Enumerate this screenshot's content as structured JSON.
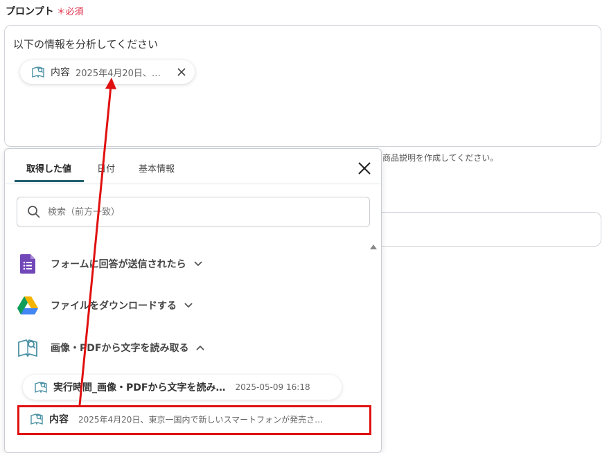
{
  "field": {
    "label": "プロンプト",
    "required_mark": "＊",
    "required_text": "必須"
  },
  "prompt": {
    "text": "以下の情報を分析してください",
    "chip": {
      "name": "内容",
      "value": "2025年4月20日、…",
      "icon": "ocr-book-icon",
      "remove_icon": "close-icon"
    }
  },
  "background": {
    "hint": "商品説明を作成してください。"
  },
  "panel": {
    "tabs": [
      {
        "label": "取得した値"
      },
      {
        "label": "日付"
      },
      {
        "label": "基本情報"
      }
    ],
    "search_placeholder": "検索（前方一致）",
    "groups": [
      {
        "label": "フォームに回答が送信されたら",
        "icon": "google-forms-icon",
        "state": "collapsed"
      },
      {
        "label": "ファイルをダウンロードする",
        "icon": "google-drive-icon",
        "state": "collapsed"
      },
      {
        "label": "画像・PDFから文字を読み取る",
        "icon": "ocr-book-icon",
        "state": "expanded"
      }
    ],
    "items": [
      {
        "name": "実行時間_画像・PDFから文字を読み…",
        "value": "2025-05-09 16:18"
      },
      {
        "name": "内容",
        "value": "2025年4月20日、東京一国内で新しいスマートフォンが発売さ…"
      }
    ]
  },
  "colors": {
    "required": "#e0314b",
    "tab_underline": "#1f5e6e",
    "annotation": "#e01010",
    "forms": "#7248b9"
  }
}
